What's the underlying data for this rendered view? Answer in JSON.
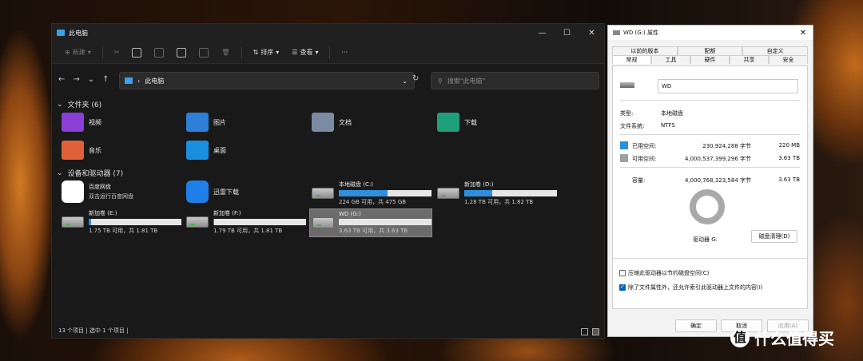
{
  "explorer": {
    "title": "此电脑",
    "toolbar": {
      "new": "新建",
      "sort": "排序",
      "view": "查看",
      "more": "···"
    },
    "address": "此电脑",
    "search_placeholder": "搜索\"此电脑\"",
    "folders_header": "文件夹 (6)",
    "folders": [
      {
        "name": "视频",
        "icon": "video-folder-icon"
      },
      {
        "name": "图片",
        "icon": "pictures-folder-icon"
      },
      {
        "name": "文档",
        "icon": "documents-folder-icon"
      },
      {
        "name": "下载",
        "icon": "downloads-folder-icon"
      },
      {
        "name": "音乐",
        "icon": "music-folder-icon"
      },
      {
        "name": "桌面",
        "icon": "desktop-folder-icon"
      }
    ],
    "devices_header": "设备和驱动器 (7)",
    "baidu": {
      "name": "百度网盘",
      "sub": "双击运行百度网盘"
    },
    "xunlei": {
      "name": "迅雷下载"
    },
    "drives": [
      {
        "name": "本地磁盘 (C:)",
        "free": "224 GB 可用，共 475 GB",
        "used_fraction": 0.53
      },
      {
        "name": "新加卷 (D:)",
        "free": "1.28 TB 可用，共 1.82 TB",
        "used_fraction": 0.3
      },
      {
        "name": "新加卷 (E:)",
        "free": "1.75 TB 可用，共 1.81 TB",
        "used_fraction": 0.03
      },
      {
        "name": "新加卷 (F:)",
        "free": "1.79 TB 可用，共 1.81 TB",
        "used_fraction": 0.01
      },
      {
        "name": "WD (G:)",
        "free": "3.63 TB 可用，共 3.63 TB",
        "used_fraction": 0.0
      }
    ],
    "status": "13 个项目  |  选中 1 个项目  |"
  },
  "props": {
    "title": "WD (G:) 属性",
    "tabs_top": [
      "以前的版本",
      "配额",
      "自定义"
    ],
    "tabs_bottom": [
      "常规",
      "工具",
      "硬件",
      "共享",
      "安全"
    ],
    "label_value": "WD",
    "type_label": "类型:",
    "type_value": "本地磁盘",
    "fs_label": "文件系统:",
    "fs_value": "NTFS",
    "used_label": "已用空间:",
    "used_bytes": "230,924,288 字节",
    "used_size": "220 MB",
    "free_label": "可用空间:",
    "free_bytes": "4,000,537,399,296 字节",
    "free_size": "3.63 TB",
    "cap_label": "容量:",
    "cap_bytes": "4,000,768,323,584 字节",
    "cap_size": "3.63 TB",
    "drive_label": "驱动器 G:",
    "cleanup": "磁盘清理(D)",
    "compress": "压缩此驱动器以节约磁盘空间(C)",
    "index": "除了文件属性外，还允许索引此驱动器上文件的内容(I)",
    "ok": "确定",
    "cancel": "取消",
    "apply": "应用(A)",
    "colors": {
      "used": "#2f8fdc",
      "free": "#a0a0a0"
    }
  },
  "watermark": "什么值得买",
  "watermark_glyph": "值"
}
